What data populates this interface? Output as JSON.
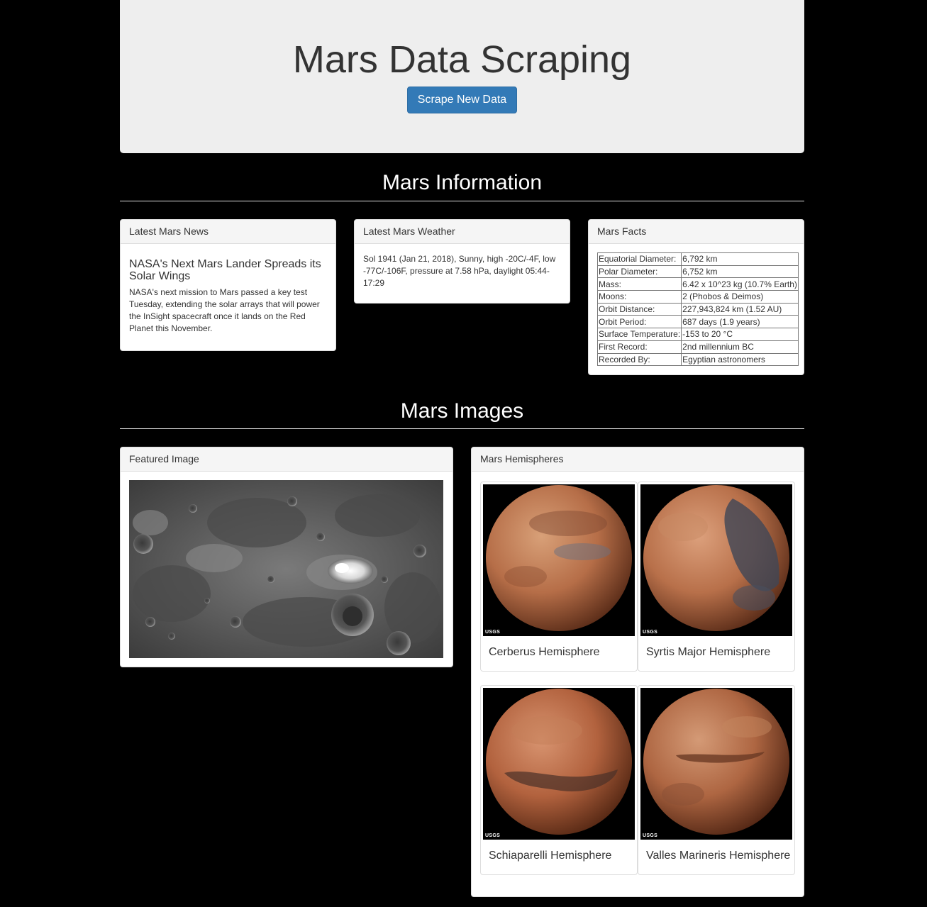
{
  "header": {
    "title": "Mars Data Scraping",
    "scrape_button": "Scrape New Data"
  },
  "info_section": {
    "title": "Mars Information"
  },
  "news": {
    "heading": "Latest Mars News",
    "title": "NASA's Next Mars Lander Spreads its Solar Wings",
    "paragraph": "NASA's next mission to Mars passed a key test Tuesday, extending the solar arrays that will power the InSight spacecraft once it lands on the Red Planet this November."
  },
  "weather": {
    "heading": "Latest Mars Weather",
    "text": "Sol 1941 (Jan 21, 2018), Sunny, high -20C/-4F, low -77C/-106F, pressure at 7.58 hPa, daylight 05:44-17:29"
  },
  "facts": {
    "heading": "Mars Facts",
    "rows": [
      {
        "label": "Equatorial Diameter:",
        "value": "6,792 km"
      },
      {
        "label": "Polar Diameter:",
        "value": "6,752 km"
      },
      {
        "label": "Mass:",
        "value": "6.42 x 10^23 kg (10.7% Earth)"
      },
      {
        "label": "Moons:",
        "value": "2 (Phobos & Deimos)"
      },
      {
        "label": "Orbit Distance:",
        "value": "227,943,824 km (1.52 AU)"
      },
      {
        "label": "Orbit Period:",
        "value": "687 days (1.9 years)"
      },
      {
        "label": "Surface Temperature:",
        "value": "-153 to 20 °C"
      },
      {
        "label": "First Record:",
        "value": "2nd millennium BC"
      },
      {
        "label": "Recorded By:",
        "value": "Egyptian astronomers"
      }
    ]
  },
  "images_section": {
    "title": "Mars Images"
  },
  "featured": {
    "heading": "Featured Image"
  },
  "hemispheres": {
    "heading": "Mars Hemispheres",
    "items": [
      {
        "title": "Cerberus Hemisphere",
        "logo": "USGS"
      },
      {
        "title": "Syrtis Major Hemisphere",
        "logo": "USGS"
      },
      {
        "title": "Schiaparelli Hemisphere",
        "logo": "USGS"
      },
      {
        "title": "Valles Marineris Hemisphere",
        "logo": "USGS"
      }
    ]
  },
  "colors": {
    "background": "#000000",
    "jumbotron": "#eeeeee",
    "primary_button": "#337ab7"
  }
}
